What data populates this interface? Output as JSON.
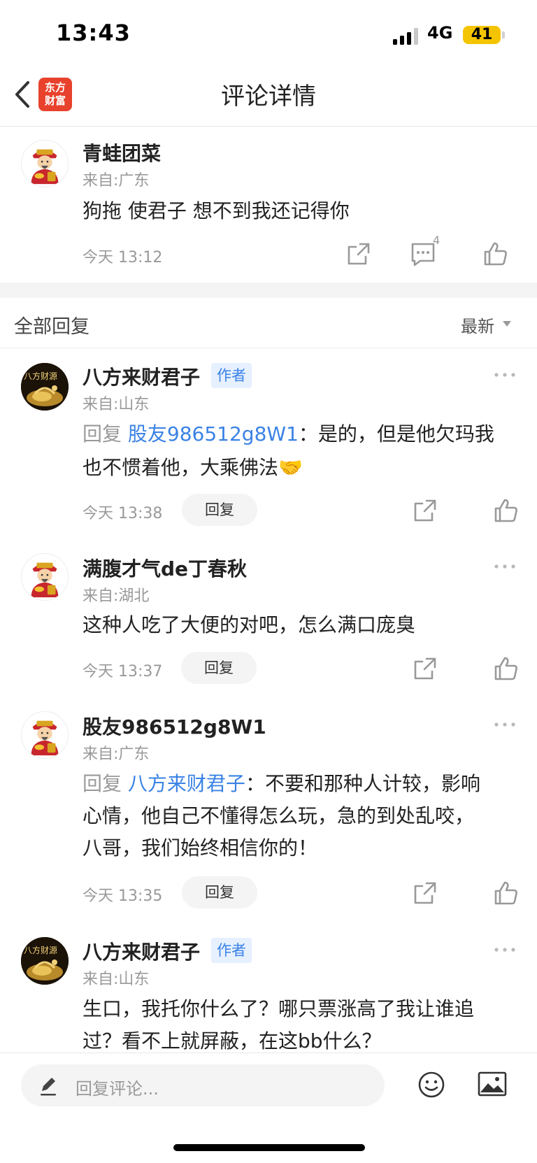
{
  "status_bar": {
    "time": "13:43",
    "network": "4G",
    "battery": "41"
  },
  "nav": {
    "logo_line1": "东方",
    "logo_line2": "财富",
    "title": "评论详情"
  },
  "main_comment": {
    "username": "青蛙团菜",
    "origin": "来自:广东",
    "content": "狗拖 使君子  想不到我还记得你",
    "time": "今天 13:12",
    "reply_count": "4"
  },
  "replies_header": {
    "title": "全部回复",
    "sort": "最新"
  },
  "replies": [
    {
      "username": "八方来财君子",
      "badge": "作者",
      "origin": "来自:山东",
      "reply_prefix": "回复",
      "reply_target": "股友986512g8W1",
      "line1_rest": "：是的，但是他欠玛我",
      "line2": "也不惯着他，大乘佛法🤝",
      "time": "今天 13:38",
      "reply_button": "回复"
    },
    {
      "username": "满腹才气de丁春秋",
      "origin": "来自:湖北",
      "content": "这种人吃了大便的对吧，怎么满口庞臭",
      "time": "今天 13:37",
      "reply_button": "回复"
    },
    {
      "username": "股友986512g8W1",
      "origin": "来自:广东",
      "reply_prefix": "回复",
      "reply_target": "八方来财君子",
      "line1_rest": "：不要和那种人计较，影响",
      "line2": "心情，他自己不懂得怎么玩，急的到处乱咬，",
      "line3": "八哥，我们始终相信你的！",
      "time": "今天 13:35",
      "reply_button": "回复"
    },
    {
      "username": "八方来财君子",
      "badge": "作者",
      "origin": "来自:山东",
      "line1": "生口，我托你什么了？哪只票涨高了我让谁追",
      "line2": "过？看不上就屏蔽，在这bb什么？"
    }
  ],
  "avatar_text": "八方财源",
  "bottom_bar": {
    "placeholder": "回复评论..."
  },
  "colors": {
    "accent_blue": "#3a82e5",
    "brand_red": "#e8412c",
    "battery": "#f5c400"
  },
  "icons": [
    "chevron-left-icon",
    "share-icon",
    "comment-icon",
    "thumbs-up-icon",
    "more-dots-icon",
    "pencil-icon",
    "emoji-icon",
    "image-icon"
  ]
}
